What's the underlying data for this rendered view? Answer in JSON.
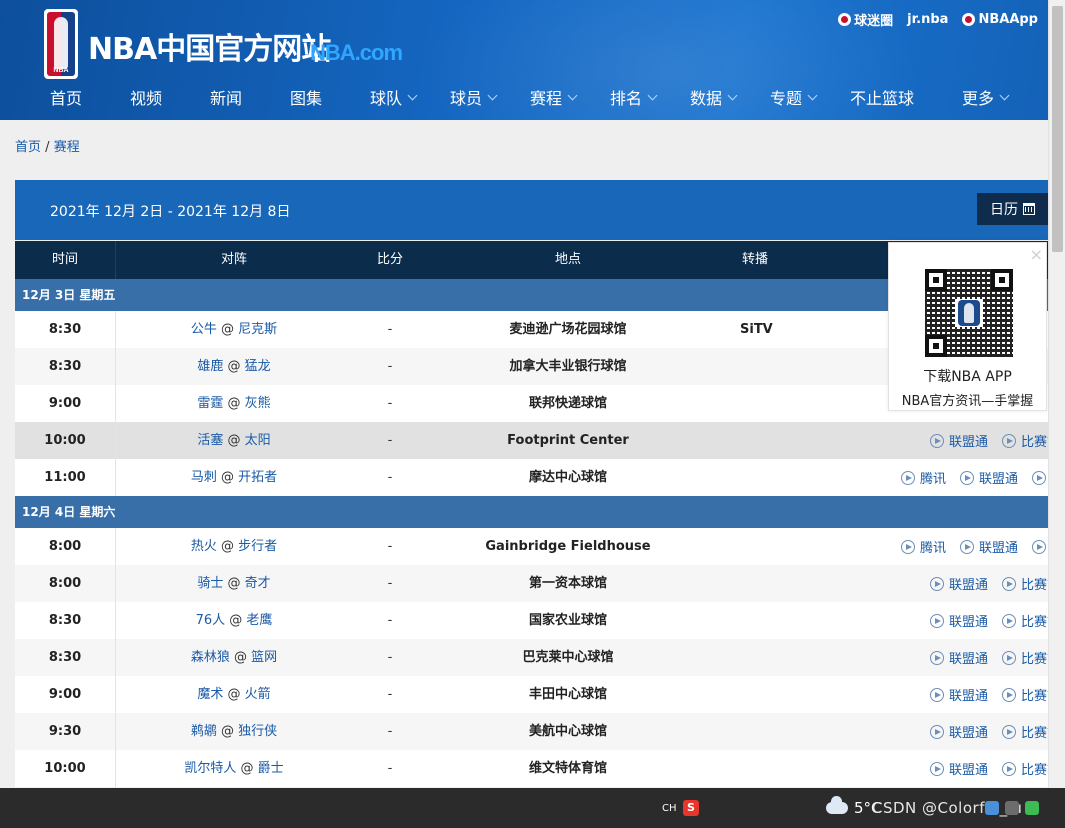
{
  "header": {
    "site_title": "NBA中国官方网站",
    "site_domain": "NBA.com",
    "top_links": [
      {
        "label": "球迷圈"
      },
      {
        "label": "jr.nba"
      },
      {
        "label": "NBAApp"
      }
    ],
    "nav": [
      {
        "label": "首页",
        "dropdown": false
      },
      {
        "label": "视频",
        "dropdown": false
      },
      {
        "label": "新闻",
        "dropdown": false
      },
      {
        "label": "图集",
        "dropdown": false
      },
      {
        "label": "球队",
        "dropdown": true
      },
      {
        "label": "球员",
        "dropdown": true
      },
      {
        "label": "赛程",
        "dropdown": true
      },
      {
        "label": "排名",
        "dropdown": true
      },
      {
        "label": "数据",
        "dropdown": true
      },
      {
        "label": "专题",
        "dropdown": true
      },
      {
        "label": "不止篮球",
        "dropdown": false
      },
      {
        "label": "更多",
        "dropdown": true
      }
    ]
  },
  "breadcrumb": {
    "home": "首页",
    "sep": "/",
    "current": "赛程"
  },
  "schedule": {
    "week_range": "2021年 12月 2日 - 2021年 12月 8日",
    "calendar_label": "日历",
    "columns": {
      "time": "时间",
      "matchup": "对阵",
      "score": "比分",
      "venue": "地点",
      "broadcast": "转播"
    },
    "days": [
      {
        "date_label": "12月 3日 星期五",
        "games": [
          {
            "time": "8:30",
            "away": "公牛",
            "at": "@",
            "home": "尼克斯",
            "score": "-",
            "venue": "麦迪逊广场花园球馆",
            "tv": "SiTV",
            "links": []
          },
          {
            "time": "8:30",
            "away": "雄鹿",
            "at": "@",
            "home": "猛龙",
            "score": "-",
            "venue": "加拿大丰业银行球馆",
            "tv": "",
            "links": []
          },
          {
            "time": "9:00",
            "away": "雷霆",
            "at": "@",
            "home": "灰熊",
            "score": "-",
            "venue": "联邦快递球馆",
            "tv": "",
            "links": []
          },
          {
            "time": "10:00",
            "away": "活塞",
            "at": "@",
            "home": "太阳",
            "score": "-",
            "venue": "Footprint Center",
            "tv": "",
            "links": [
              "联盟通",
              "比赛前瞻"
            ]
          },
          {
            "time": "11:00",
            "away": "马刺",
            "at": "@",
            "home": "开拓者",
            "score": "-",
            "venue": "摩达中心球馆",
            "tv": "",
            "links": [
              "腾讯",
              "联盟通",
              "比赛前瞻"
            ]
          }
        ]
      },
      {
        "date_label": "12月 4日 星期六",
        "games": [
          {
            "time": "8:00",
            "away": "热火",
            "at": "@",
            "home": "步行者",
            "score": "-",
            "venue": "Gainbridge Fieldhouse",
            "tv": "",
            "links": [
              "腾讯",
              "联盟通",
              "比赛前瞻"
            ]
          },
          {
            "time": "8:00",
            "away": "骑士",
            "at": "@",
            "home": "奇才",
            "score": "-",
            "venue": "第一资本球馆",
            "tv": "",
            "links": [
              "联盟通",
              "比赛前瞻"
            ]
          },
          {
            "time": "8:30",
            "away": "76人",
            "at": "@",
            "home": "老鹰",
            "score": "-",
            "venue": "国家农业球馆",
            "tv": "",
            "links": [
              "联盟通",
              "比赛前瞻"
            ]
          },
          {
            "time": "8:30",
            "away": "森林狼",
            "at": "@",
            "home": "篮网",
            "score": "-",
            "venue": "巴克莱中心球馆",
            "tv": "",
            "links": [
              "联盟通",
              "比赛前瞻"
            ]
          },
          {
            "time": "9:00",
            "away": "魔术",
            "at": "@",
            "home": "火箭",
            "score": "-",
            "venue": "丰田中心球馆",
            "tv": "",
            "links": [
              "联盟通",
              "比赛前瞻"
            ]
          },
          {
            "time": "9:30",
            "away": "鹈鹕",
            "at": "@",
            "home": "独行侠",
            "score": "-",
            "venue": "美航中心球馆",
            "tv": "",
            "links": [
              "联盟通",
              "比赛前瞻"
            ]
          },
          {
            "time": "10:00",
            "away": "凯尔特人",
            "at": "@",
            "home": "爵士",
            "score": "-",
            "venue": "维文特体育馆",
            "tv": "",
            "links": [
              "联盟通",
              "比赛前瞻"
            ]
          }
        ]
      }
    ]
  },
  "app_popup": {
    "close": "×",
    "title": "下载NBA APP",
    "subtitle": "NBA官方资讯—手掌握"
  },
  "taskbar": {
    "ime": "CH",
    "sogou": "S",
    "weather": "5°C",
    "watermark": "CSDN @Colorful_lu"
  }
}
